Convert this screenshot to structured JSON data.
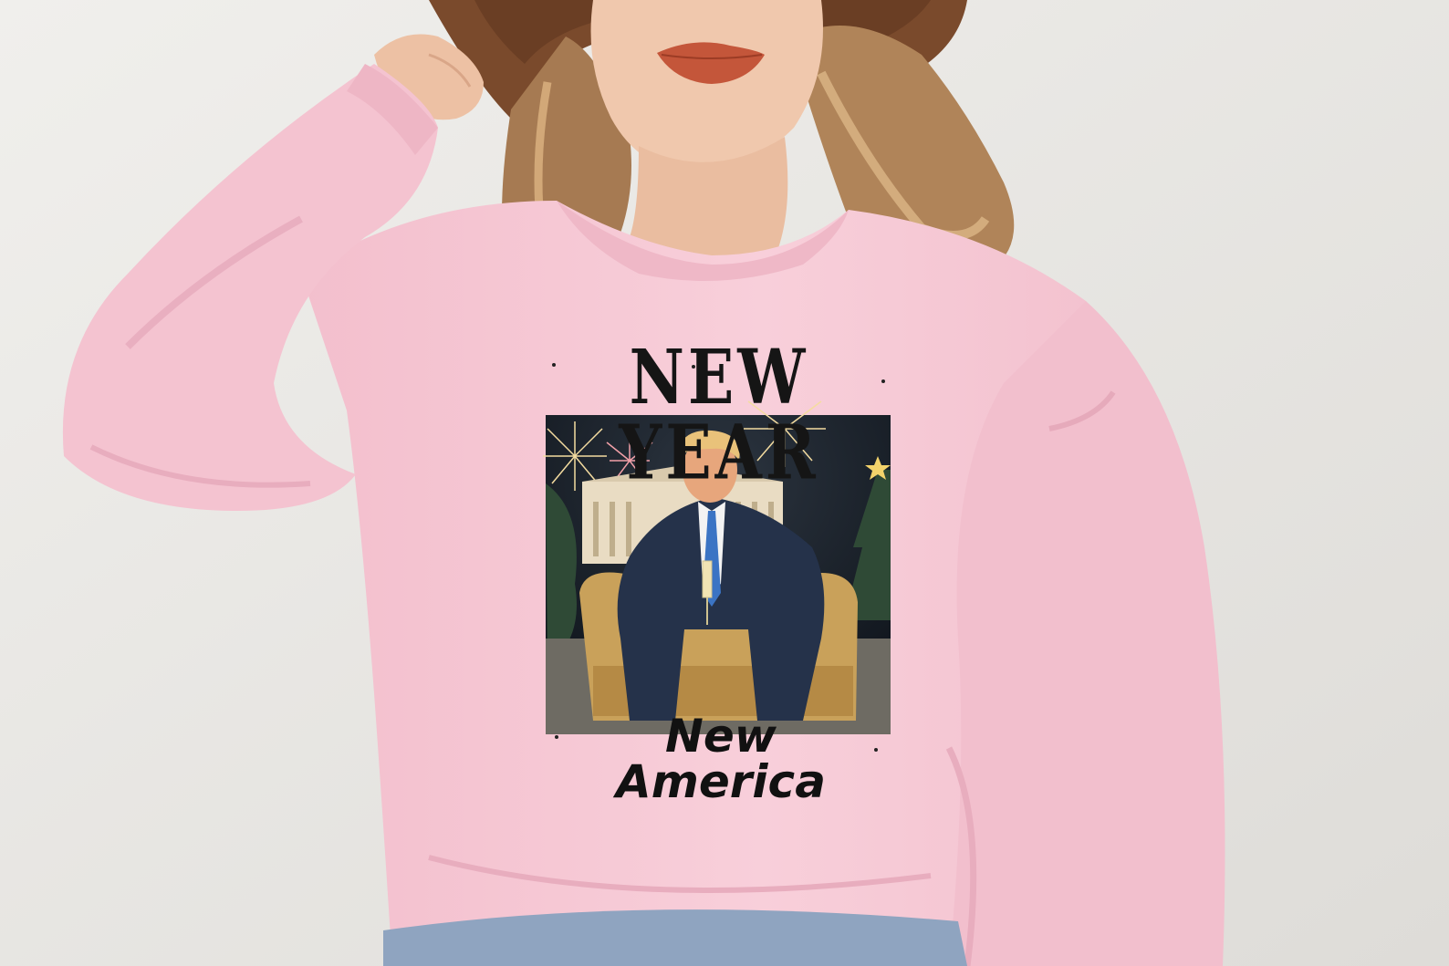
{
  "photo": {
    "subject": "woman-wearing-pink-sweatshirt",
    "colors": {
      "background": "#e9e7e4",
      "sweatshirt": "#f6c8d4",
      "sweatshirt_shadow": "#eab3c2",
      "hair": "#b58a5f",
      "hat": "#7a4a2c",
      "skin": "#f0c8ad",
      "lips": "#c4563a",
      "jeans": "#8fa4c0"
    }
  },
  "print": {
    "title": "NEW YEAR",
    "subtitle": "New America",
    "colors": {
      "night_sky": "#17202b",
      "firework_gold": "#f4dca0",
      "firework_pink": "#f2a0a8",
      "building": "#e9dcc3",
      "tree": "#2f4a36",
      "suit": "#25324a",
      "tie": "#3b74c4",
      "armchair": "#c9a15a",
      "star": "#f3d36b"
    }
  }
}
